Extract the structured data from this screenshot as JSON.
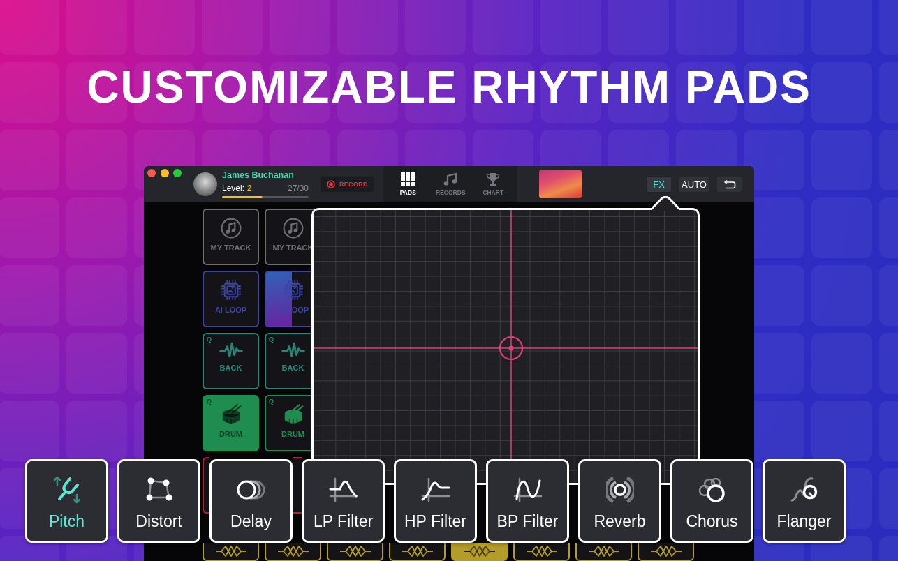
{
  "title": "CUSTOMIZABLE RHYTHM PADS",
  "window": {
    "user": {
      "name": "James Buchanan",
      "level_label": "Level:",
      "level_number": "2",
      "progress_text": "27/30",
      "level": 0.47
    },
    "record_button": {
      "label": "RECORD"
    },
    "nav_tabs": [
      {
        "kind": "grid",
        "label": "PADS",
        "selected": true
      },
      {
        "kind": "notes",
        "label": "RECORDS",
        "selected": false
      },
      {
        "kind": "trophy",
        "label": "CHART",
        "selected": false
      }
    ],
    "mode_buttons": [
      {
        "kind": "text",
        "label": "FX",
        "selected": true
      },
      {
        "kind": "text",
        "label": "AUTO",
        "selected": false
      },
      {
        "kind": "icon",
        "selected": false
      }
    ]
  },
  "pad_rows": [
    [
      {
        "kind": "note",
        "label": "MY TRACK",
        "color": "#6e6f73",
        "active": false
      },
      {
        "kind": "note",
        "label": "MY TRACK",
        "color": "#6e6f73",
        "active": false
      }
    ],
    [
      {
        "kind": "chip",
        "label": "AI LOOP",
        "color": "#3d46a6",
        "active": false
      },
      {
        "kind": "chip",
        "label": "AI LOOP",
        "color": "#3d46a6",
        "active": false,
        "level": 0.48
      }
    ],
    [
      {
        "kind": "wave",
        "corner": "Q",
        "label": "BACK",
        "color": "#2b8577",
        "active": false
      },
      {
        "kind": "wave",
        "corner": "Q",
        "label": "BACK",
        "color": "#2b8577",
        "active": false
      }
    ],
    [
      {
        "kind": "drum",
        "corner": "Q",
        "label": "DRUM",
        "color": "#1f8c50",
        "active": true
      },
      {
        "kind": "drum",
        "corner": "Q",
        "label": "DRUM",
        "color": "#1f8c50",
        "active": false
      }
    ]
  ],
  "middle_pads": [
    {
      "color": "#b4232f",
      "active": false
    },
    {
      "color": "#b4232f",
      "active": false
    }
  ],
  "lower_pads": [
    {
      "kind": "zigzag",
      "color": "#b49c28",
      "active": false
    },
    {
      "kind": "zigzag",
      "color": "#b49c28",
      "active": false
    },
    {
      "kind": "zigzag",
      "color": "#b49c28",
      "active": false
    },
    {
      "kind": "zigzag",
      "color": "#b49c28",
      "active": false
    },
    {
      "kind": "zigzag",
      "color": "#b49c28",
      "active": true
    },
    {
      "kind": "zigzag",
      "color": "#b49c28",
      "active": false
    },
    {
      "kind": "zigzag",
      "color": "#b49c28",
      "active": false
    },
    {
      "kind": "zigzag",
      "color": "#b49c28",
      "active": false
    }
  ],
  "fx_buttons": [
    {
      "kind": "pitch",
      "label": "Pitch",
      "selected": true
    },
    {
      "kind": "distort",
      "label": "Distort",
      "selected": false
    },
    {
      "kind": "delay",
      "label": "Delay",
      "selected": false
    },
    {
      "kind": "lowpass",
      "label": "LP Filter",
      "selected": false
    },
    {
      "kind": "highpass",
      "label": "HP Filter",
      "selected": false
    },
    {
      "kind": "bandpass",
      "label": "BP Filter",
      "selected": false
    },
    {
      "kind": "reverb",
      "label": "Reverb",
      "selected": false
    },
    {
      "kind": "chorus",
      "label": "Chorus",
      "selected": false
    },
    {
      "kind": "flanger",
      "label": "Flanger",
      "selected": false
    }
  ]
}
